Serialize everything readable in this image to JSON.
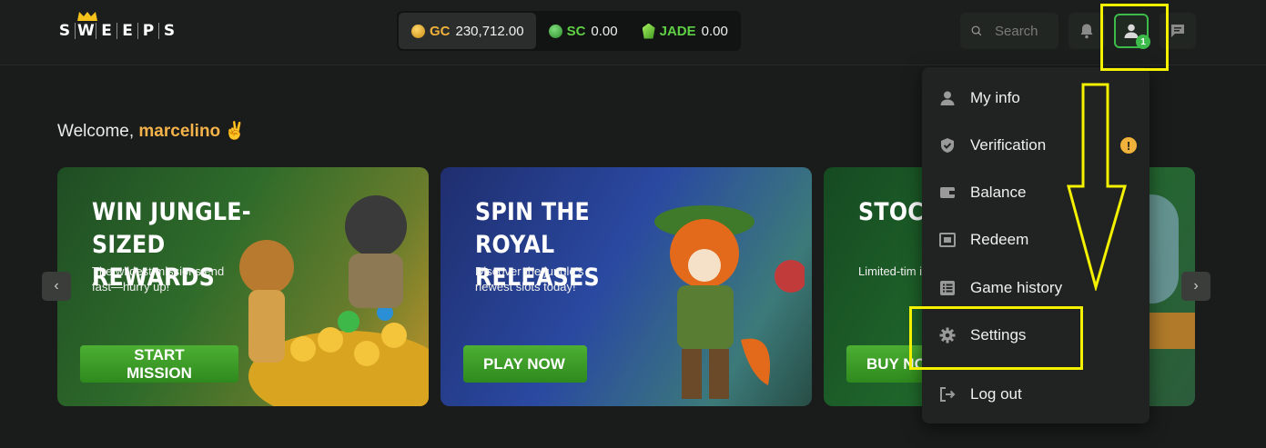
{
  "brand": {
    "letters": [
      "S",
      "W",
      "E",
      "E",
      "P",
      "S"
    ]
  },
  "balances": [
    {
      "code": "GC",
      "amount": "230,712.00",
      "icon": "gold-coin-icon",
      "color": "#f0b23a"
    },
    {
      "code": "SC",
      "amount": "0.00",
      "icon": "green-coin-icon",
      "color": "#5fcf45"
    },
    {
      "code": "JADE",
      "amount": "0.00",
      "icon": "jade-gem-icon",
      "color": "#5fcf45"
    }
  ],
  "search": {
    "placeholder": "Search"
  },
  "profile": {
    "notification_count": "1"
  },
  "welcome": {
    "greeting": "Welcome,",
    "username": "marcelino",
    "emoji": "✌"
  },
  "banners": [
    {
      "title": "WIN JUNGLE-SIZED REWARDS",
      "subtitle": "The wildest missions end fast—hurry up!",
      "cta": "START MISSION"
    },
    {
      "title": "SPIN THE ROYAL RELEASES",
      "subtitle": "Discover the jungle's newest slots today!",
      "cta": "PLAY NOW"
    },
    {
      "title": "STOCK ON CO",
      "subtitle": "Limited-tim in the jungle",
      "cta": "BUY NO"
    }
  ],
  "menu": [
    {
      "label": "My info",
      "icon": "user-icon"
    },
    {
      "label": "Verification",
      "icon": "shield-check-icon",
      "warning": "!"
    },
    {
      "label": "Balance",
      "icon": "wallet-icon"
    },
    {
      "label": "Redeem",
      "icon": "redeem-icon"
    },
    {
      "label": "Game history",
      "icon": "list-icon"
    },
    {
      "label": "Settings",
      "icon": "gear-icon"
    },
    {
      "label": "Log out",
      "icon": "logout-icon"
    }
  ],
  "colors": {
    "accent_green": "#3dbb4a",
    "highlight_yellow": "#f3f000",
    "username_orange": "#f4b24a"
  }
}
